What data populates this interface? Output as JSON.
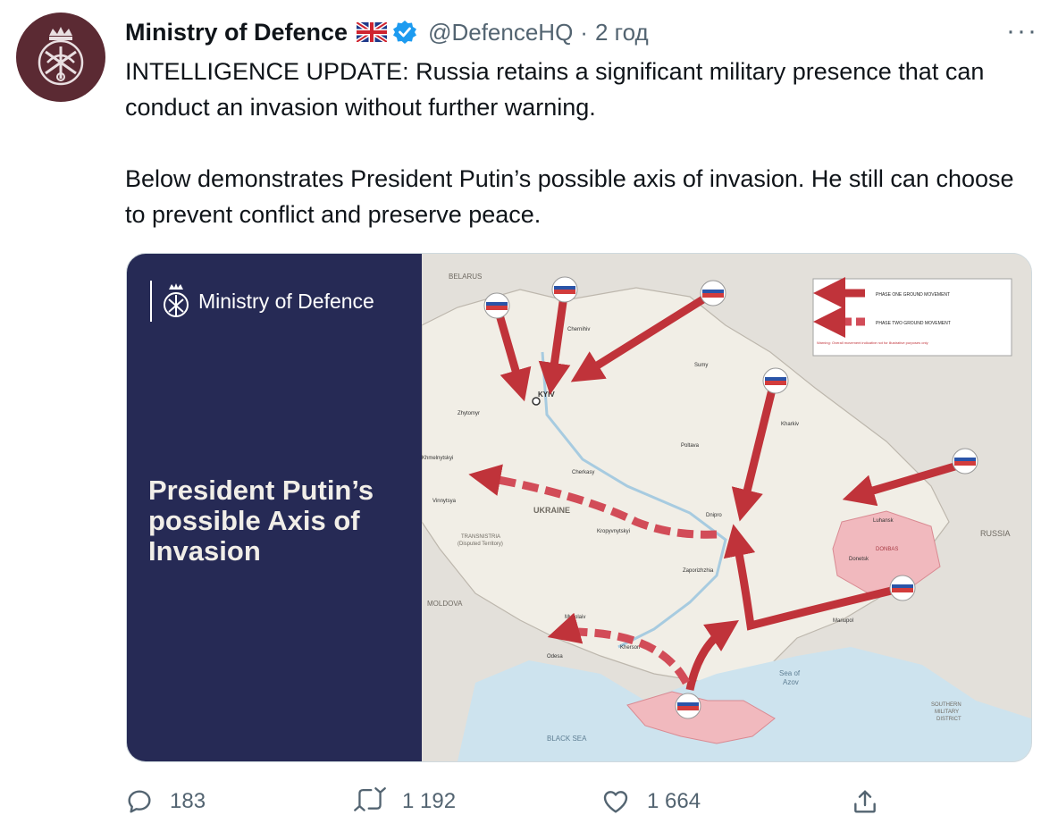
{
  "account": {
    "name": "Ministry of Defence",
    "handle": "@DefenceHQ",
    "separator": "·",
    "time": "2 год",
    "more_label": "···"
  },
  "tweet": {
    "paragraph1": "INTELLIGENCE UPDATE: Russia retains a significant military presence that can conduct an invasion without further warning.",
    "paragraph2": "Below demonstrates President Putin’s possible axis of invasion. He still can choose to prevent conflict and preserve peace."
  },
  "media": {
    "brand": "Ministry of Defence",
    "title_line1": "President Putin’s",
    "title_line2": "possible Axis of",
    "title_line3": "Invasion",
    "map_labels": {
      "belarus": "BELARUS",
      "kyiv": "KYIV",
      "ukraine": "UKRAINE",
      "russia": "RUSSIA",
      "moldova": "MOLDOVA",
      "transnistria": "TRANSNISTRIA",
      "transnistria_note": "(Disputed Territory)",
      "black_sea": "BLACK SEA",
      "sea_of_azov1": "Sea of",
      "sea_of_azov2": "Azov",
      "smd1": "SOUTHERN",
      "smd2": "MILITARY",
      "smd3": "DISTRICT",
      "donbas": "DONBAS",
      "luhansk": "Luhansk",
      "donetsk": "Donetsk",
      "chernihiv": "Chernihiv",
      "sumy": "Sumy",
      "kharkiv": "Kharkiv",
      "poltava": "Poltava",
      "zhytomyr": "Zhytomyr",
      "vinnytsia": "Vinnytsya",
      "cherkasy": "Cherkasy",
      "kropyvnytskyi": "Kropyvnytskyi",
      "dnipro": "Dnipro",
      "zaporizhzhia": "Zaporizhzhia",
      "mykolaiv": "Mykolaiv",
      "kherson": "Kherson",
      "odesa": "Odesa",
      "mariupol": "Mariupol",
      "khmelnytskyi": "Khmelnytskyi"
    },
    "legend": {
      "phase_one": "PHASE ONE GROUND MOVEMENT",
      "phase_two": "PHASE TWO GROUND MOVEMENT",
      "warning": "Warning: Overall movement indicative not for illustrative purposes only"
    },
    "colors": {
      "arrow": "#c0333a",
      "panel": "#262a55",
      "occupied": "#f1b9be",
      "sea": "#cde3ee",
      "land": "#f1eee6"
    }
  },
  "actions": {
    "replies": "183",
    "retweets": "1 192",
    "likes": "1 664"
  }
}
